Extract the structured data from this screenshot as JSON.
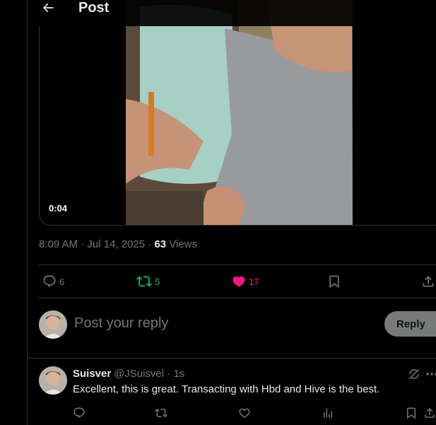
{
  "header": {
    "title": "Post"
  },
  "media": {
    "duration": "0:04"
  },
  "meta": {
    "time": "8:09 AM",
    "date": "Jul 14, 2025",
    "views_count": "63",
    "views_label": "Views"
  },
  "actions": {
    "replies": "6",
    "reposts": "5",
    "likes": "17"
  },
  "colors": {
    "repost": "#00ba7c",
    "like": "#f91880",
    "muted": "#71767b"
  },
  "composer": {
    "placeholder": "Post your reply",
    "button": "Reply"
  },
  "reply": {
    "name": "Suisver",
    "handle": "@JSuisvel",
    "time": "1s",
    "text": "Excellent, this is great. Transacting with Hbd and Hive is the best."
  },
  "icons": [
    "back-arrow-icon",
    "reply-icon",
    "repost-icon",
    "like-icon",
    "bookmark-icon",
    "share-icon",
    "grok-icon",
    "more-icon",
    "analytics-icon"
  ]
}
